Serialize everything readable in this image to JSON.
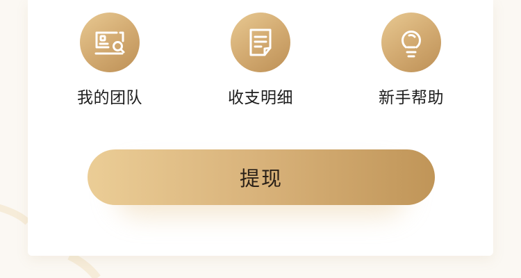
{
  "theme": {
    "accent_light": "#ebcd96",
    "accent_dark": "#c09558",
    "text": "#1d1d1d",
    "card_bg": "#ffffff"
  },
  "menu": {
    "items": [
      {
        "label": "我的团队",
        "icon": "team-id-card-search-icon"
      },
      {
        "label": "收支明细",
        "icon": "document-list-icon"
      },
      {
        "label": "新手帮助",
        "icon": "lightbulb-help-icon"
      }
    ]
  },
  "withdraw": {
    "label": "提现"
  }
}
